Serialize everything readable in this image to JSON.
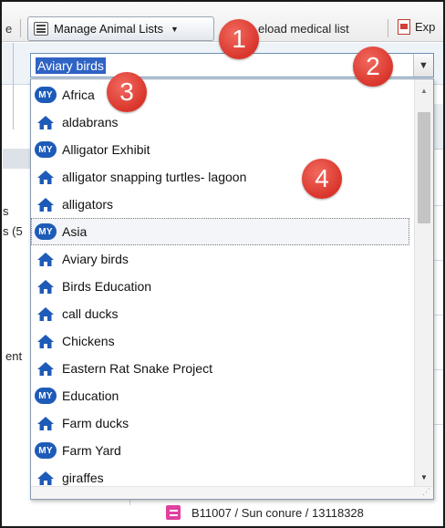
{
  "toolbar": {
    "left_fragment": "e",
    "manage_label": "Manage Animal Lists",
    "reload_label": "eload medical list",
    "export_label": "Exp"
  },
  "combo": {
    "value": "Aviary birds"
  },
  "dropdown": {
    "items": [
      {
        "label": "Africa",
        "type": "my"
      },
      {
        "label": "aldabrans",
        "type": "home"
      },
      {
        "label": "Alligator Exhibit",
        "type": "my"
      },
      {
        "label": "alligator snapping turtles- lagoon",
        "type": "home"
      },
      {
        "label": "alligators",
        "type": "home"
      },
      {
        "label": "Asia",
        "type": "my",
        "selected": true
      },
      {
        "label": "Aviary birds",
        "type": "home"
      },
      {
        "label": "Birds Education",
        "type": "home"
      },
      {
        "label": "call ducks",
        "type": "home"
      },
      {
        "label": "Chickens",
        "type": "home"
      },
      {
        "label": "Eastern Rat Snake Project",
        "type": "home"
      },
      {
        "label": "Education",
        "type": "my"
      },
      {
        "label": "Farm ducks",
        "type": "home"
      },
      {
        "label": "Farm Yard",
        "type": "my"
      },
      {
        "label": "giraffes",
        "type": "home"
      }
    ],
    "badge_text": "MY",
    "badge_color": "#1e5bb8",
    "home_icon_color": "#1e5bb8"
  },
  "background": {
    "frag_s": "s",
    "frag_s5": "s (5",
    "frag_ent": "ent",
    "record_label": "B11007 / Sun conure / 13118328"
  },
  "callouts": [
    "1",
    "2",
    "3",
    "4"
  ],
  "colors": {
    "callout": "#d9352b",
    "selection": "#2f63c4"
  }
}
